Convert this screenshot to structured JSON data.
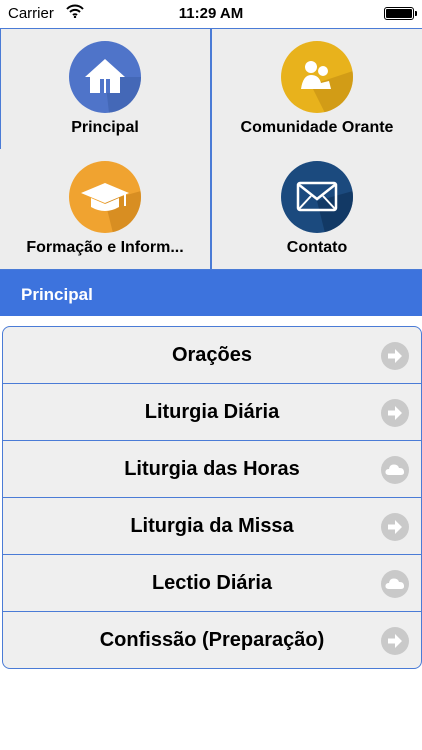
{
  "status_bar": {
    "carrier": "Carrier",
    "time": "11:29 AM",
    "wifi_icon": "wifi-icon",
    "battery_icon": "battery-icon"
  },
  "grid": {
    "items": [
      {
        "label": "Principal",
        "icon": "home-icon",
        "color": "#4f74c9"
      },
      {
        "label": "Comunidade Orante",
        "icon": "people-icon",
        "color": "#e8b21c"
      },
      {
        "label": "Formação e Inform...",
        "icon": "graduation-cap-icon",
        "color": "#f0a330"
      },
      {
        "label": "Contato",
        "icon": "envelope-icon",
        "color": "#1b4a7e"
      }
    ]
  },
  "section": {
    "title": "Principal"
  },
  "list": {
    "items": [
      {
        "title": "Orações",
        "accessory": "arrow-right-icon"
      },
      {
        "title": "Liturgia Diária",
        "accessory": "arrow-right-icon"
      },
      {
        "title": "Liturgia das Horas",
        "accessory": "cloud-icon"
      },
      {
        "title": "Liturgia da Missa",
        "accessory": "arrow-right-icon"
      },
      {
        "title": "Lectio Diária",
        "accessory": "cloud-icon"
      },
      {
        "title": "Confissão (Preparação)",
        "accessory": "arrow-right-icon"
      }
    ]
  },
  "colors": {
    "accent": "#3d73dd",
    "border": "#4a7bd6",
    "list_bg": "#efefef",
    "accessory": "#c9c9c9"
  }
}
